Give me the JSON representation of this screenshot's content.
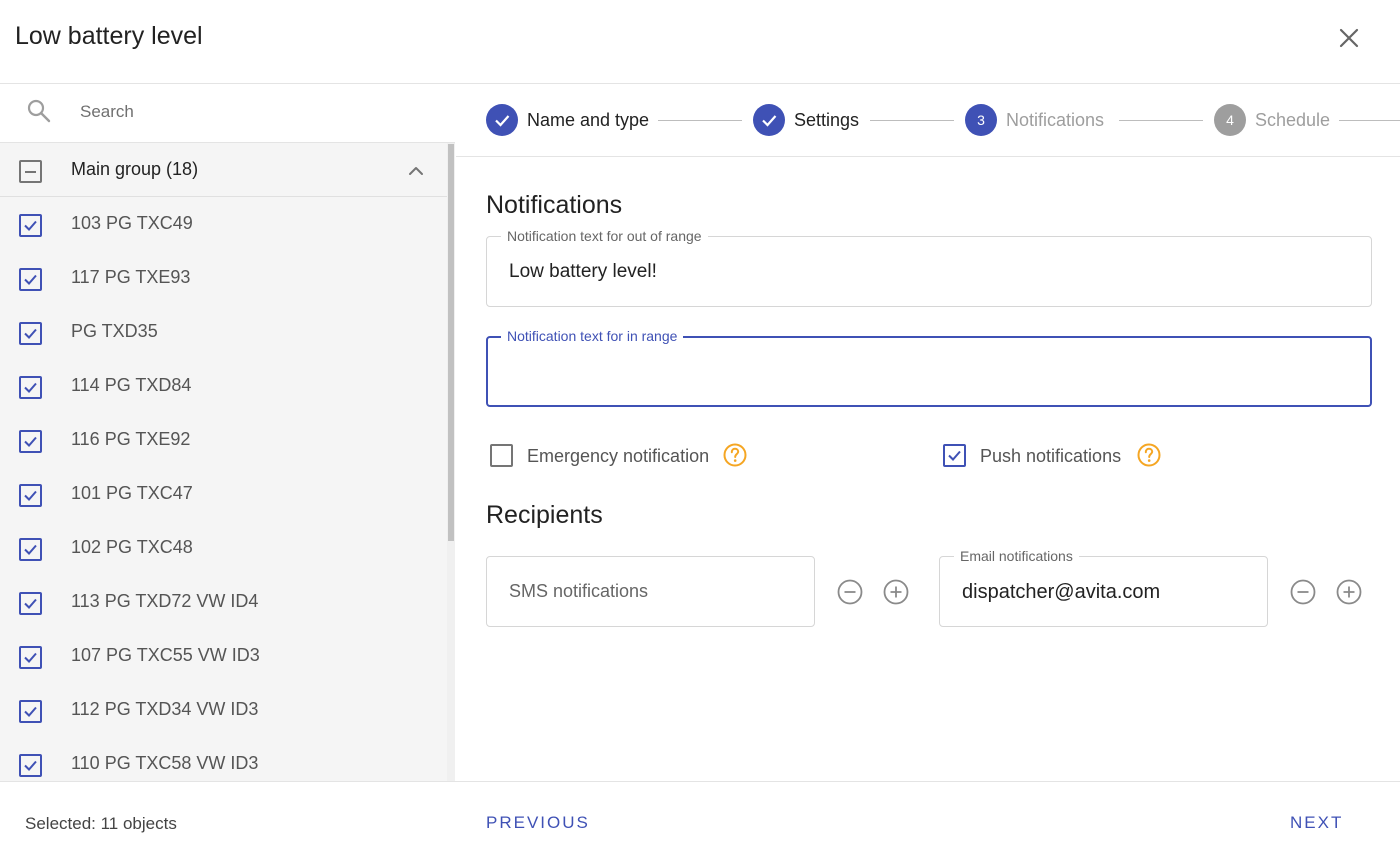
{
  "dialog": {
    "title": "Low battery level"
  },
  "search": {
    "placeholder": "Search"
  },
  "group": {
    "label": "Main group  (18)"
  },
  "items": [
    {
      "label": "103 PG TXC49",
      "checked": true
    },
    {
      "label": "117 PG TXE93",
      "checked": true
    },
    {
      "label": "PG TXD35",
      "checked": true
    },
    {
      "label": "114 PG TXD84",
      "checked": true
    },
    {
      "label": "116 PG TXE92",
      "checked": true
    },
    {
      "label": "101 PG TXC47",
      "checked": true
    },
    {
      "label": "102 PG TXC48",
      "checked": true
    },
    {
      "label": "113 PG TXD72 VW ID4",
      "checked": true
    },
    {
      "label": "107 PG TXC55 VW ID3",
      "checked": true
    },
    {
      "label": "112 PG TXD34 VW ID3",
      "checked": true
    },
    {
      "label": "110 PG TXC58 VW ID3",
      "checked": true
    }
  ],
  "footer": {
    "selected": "Selected: 11 objects",
    "previous": "PREVIOUS",
    "next": "NEXT"
  },
  "stepper": {
    "steps": [
      {
        "label": "Name and type",
        "status": "done"
      },
      {
        "label": "Settings",
        "status": "done"
      },
      {
        "number": "3",
        "label": "Notifications",
        "status": "active"
      },
      {
        "number": "4",
        "label": "Schedule",
        "status": "pending"
      }
    ]
  },
  "notifications": {
    "title": "Notifications",
    "out_of_range": {
      "label": "Notification text for out of range",
      "value": "Low battery level!"
    },
    "in_range": {
      "label": "Notification text for in range",
      "value": ""
    },
    "emergency": {
      "label": "Emergency notification",
      "checked": false
    },
    "push": {
      "label": "Push notifications",
      "checked": true
    }
  },
  "recipients": {
    "title": "Recipients",
    "sms": {
      "placeholder": "SMS notifications"
    },
    "email": {
      "label": "Email notifications",
      "value": "dispatcher@avita.com"
    }
  },
  "colors": {
    "primary": "#3f51b5",
    "help": "#f5a623",
    "inactive_step": "#9e9e9e"
  }
}
